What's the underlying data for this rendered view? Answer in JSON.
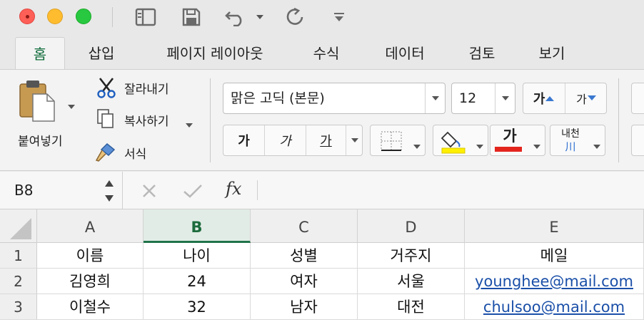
{
  "tabs": [
    "홈",
    "삽입",
    "페이지 레이아웃",
    "수식",
    "데이터",
    "검토",
    "보기"
  ],
  "ribbon": {
    "paste": "붙여넣기",
    "cut": "잘라내기",
    "copy": "복사하기",
    "format_painter": "서식",
    "font_name": "맑은 고딕 (본문)",
    "font_size": "12",
    "grow_font": "가",
    "shrink_font": "가",
    "bold": "가",
    "italic": "가",
    "underline": "가",
    "font_color": "가",
    "phonetic_top": "내천",
    "phonetic_bottom": "川",
    "highlight_color": "#ffef00",
    "font_color_hex": "#e3251e"
  },
  "formula_bar": {
    "name_box": "B8",
    "fx": "fx",
    "content": ""
  },
  "grid": {
    "columns": [
      "A",
      "B",
      "C",
      "D",
      "E"
    ],
    "selected_column": "B",
    "rows": [
      {
        "num": "1",
        "cells": [
          "이름",
          "나이",
          "성별",
          "거주지",
          "메일"
        ]
      },
      {
        "num": "2",
        "cells": [
          "김영희",
          "24",
          "여자",
          "서울",
          "younghee@mail.com"
        ]
      },
      {
        "num": "3",
        "cells": [
          "이철수",
          "32",
          "남자",
          "대전",
          "chulsoo@mail.com"
        ]
      }
    ]
  }
}
